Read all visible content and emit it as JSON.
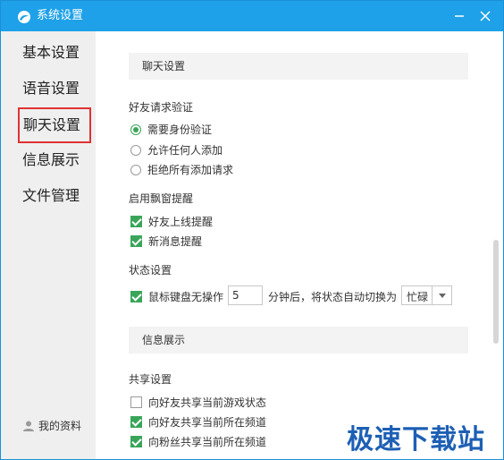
{
  "window": {
    "title": "系统设置",
    "accent_color": "#1ea1e8"
  },
  "sidebar": {
    "items": [
      {
        "label": "基本设置"
      },
      {
        "label": "语音设置"
      },
      {
        "label": "聊天设置",
        "active": true
      },
      {
        "label": "信息展示"
      },
      {
        "label": "文件管理"
      }
    ],
    "profile_label": "我的资料"
  },
  "main": {
    "chat_section": {
      "header": "聊天设置",
      "friend_request": {
        "label": "好友请求验证",
        "options": [
          {
            "label": "需要身份验证",
            "selected": true
          },
          {
            "label": "允许任何人添加",
            "selected": false
          },
          {
            "label": "拒绝所有添加请求",
            "selected": false
          }
        ]
      },
      "popup": {
        "label": "启用飘窗提醒",
        "options": [
          {
            "label": "好友上线提醒",
            "checked": true
          },
          {
            "label": "新消息提醒",
            "checked": true
          }
        ]
      },
      "status": {
        "label": "状态设置",
        "idle_label": "鼠标键盘无操作",
        "idle_checked": true,
        "minutes_value": "5",
        "after_text": "分钟后，将状态自动切换为",
        "status_value": "忙碌"
      }
    },
    "info_section": {
      "header": "信息展示",
      "share": {
        "label": "共享设置",
        "options": [
          {
            "label": "向好友共享当前游戏状态",
            "checked": false
          },
          {
            "label": "向好友共享当前所在频道",
            "checked": true
          },
          {
            "label": "向粉丝共享当前所在频道",
            "checked": true
          }
        ]
      }
    }
  },
  "watermark": "极速下载站",
  "colors": {
    "check_green": "#3aa55a",
    "active_border": "#e03232"
  }
}
